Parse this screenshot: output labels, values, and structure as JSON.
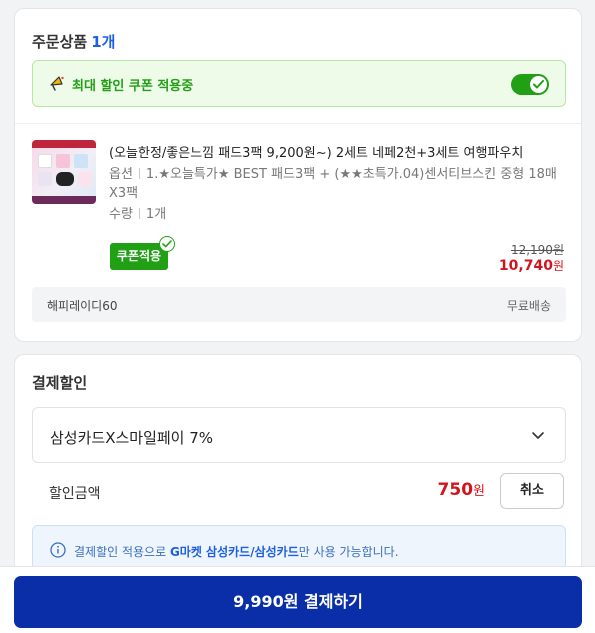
{
  "order": {
    "title": "주문상품",
    "count": "1개",
    "coupon_banner_text": "최대 할인 쿠폰 적용중",
    "coupon_toggle_on": true,
    "product": {
      "title": "(오늘한정/좋은느낌 패드3팩 9,200원~) 2세트 네페2천+3세트 여행파우치",
      "option_label": "옵션",
      "option_value": "1.★오늘특가★ BEST 패드3팩 + (★★초특가.04)센서티브스킨 중형 18매X3팩",
      "qty_label": "수량",
      "qty_value": "1개",
      "coupon_badge": "쿠폰적용",
      "original_price": "12,190",
      "sale_price": "10,740",
      "currency": "원"
    },
    "seller": "해피레이디60",
    "shipping": "무료배송"
  },
  "payment_discount": {
    "title": "결제할인",
    "selected_option": "삼성카드X스마일페이 7%",
    "discount_label": "할인금액",
    "discount_amount": "750",
    "currency": "원",
    "cancel_label": "취소",
    "info_prefix": "결제할인 적용으로 ",
    "info_highlight": "G마켓 삼성카드/삼성카드",
    "info_suffix": "만 사용 가능합니다."
  },
  "pay_button": "9,990원 결제하기",
  "colors": {
    "accent_blue": "#1f5fe3",
    "pay_button_bg": "#0a2ea8",
    "coupon_green": "#21a016",
    "sale_red": "#d3141e"
  }
}
